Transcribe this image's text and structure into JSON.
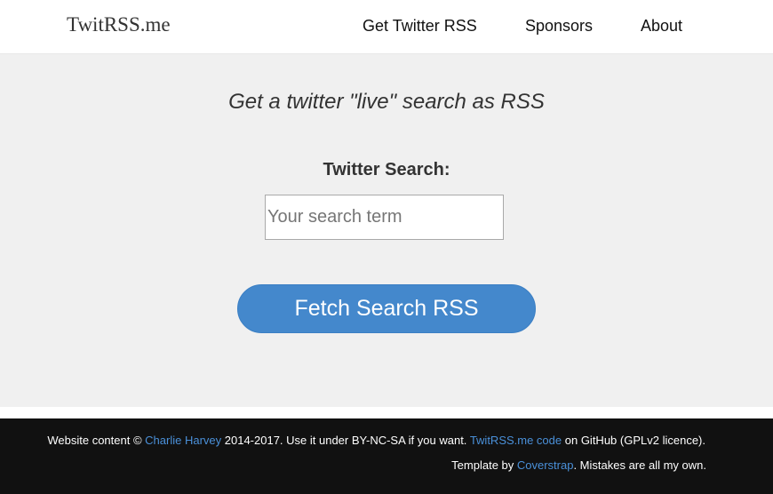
{
  "navbar": {
    "brand": "TwitRSS.me",
    "links": [
      "Get Twitter RSS",
      "Sponsors",
      "About"
    ]
  },
  "main": {
    "tagline": "Get a twitter \"live\" search as RSS",
    "search_label": "Twitter Search:",
    "search_placeholder": "Your search term",
    "search_value": "",
    "fetch_button_label": "Fetch Search RSS"
  },
  "footer": {
    "line1": {
      "prefix": "Website content © ",
      "author_link": "Charlie Harvey",
      "middle": " 2014-2017. Use it under BY-NC-SA if you want. ",
      "code_link": "TwitRSS.me code",
      "suffix": " on GitHub (GPLv2 licence)."
    },
    "line2": {
      "prefix": "Template by ",
      "template_link": "Coverstrap",
      "suffix": ". Mistakes are all my own."
    }
  },
  "colors": {
    "accent": "#4488cc",
    "main_bg": "#f0f0f0",
    "footer_bg": "#111111",
    "link": "#4a90d9"
  }
}
